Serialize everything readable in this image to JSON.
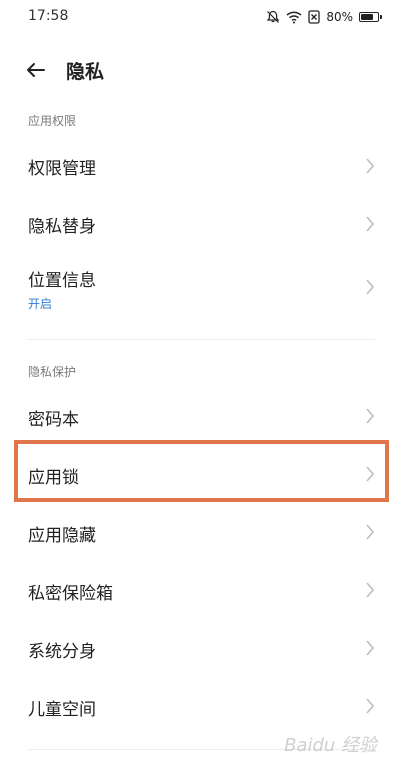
{
  "status_bar": {
    "time": "17:58",
    "battery": "80%",
    "battery_level": 0.8,
    "icons": [
      "bell-muted-icon",
      "wifi-icon",
      "sim-blocked-icon",
      "battery-icon"
    ]
  },
  "header": {
    "title": "隐私",
    "back_icon": "arrow-left-icon"
  },
  "sections": [
    {
      "title": "应用权限",
      "items": [
        {
          "label": "权限管理"
        },
        {
          "label": "隐私替身"
        },
        {
          "label": "位置信息",
          "sub": "开启"
        }
      ]
    },
    {
      "title": "隐私保护",
      "items": [
        {
          "label": "密码本"
        },
        {
          "label": "应用锁",
          "highlighted": true
        },
        {
          "label": "应用隐藏"
        },
        {
          "label": "私密保险箱"
        },
        {
          "label": "系统分身"
        },
        {
          "label": "儿童空间"
        }
      ]
    }
  ],
  "colors": {
    "highlight": "#e0764a",
    "sub_text": "#2f7fd6"
  },
  "watermark": "Baidu 经验"
}
